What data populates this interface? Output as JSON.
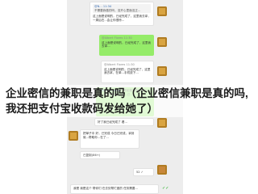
{
  "overlay": {
    "title": "企业密信的兼职是真的吗（企业密信兼职是真的吗,我还把支付宝收款码发给她了）"
  },
  "chat": {
    "top_quote": "@N... 11:34",
    "top_quote_body": "不需要我做的吗，没开心里面没正...",
    "top_reply": "这上面是说明的，已经完成了，这里我去拿，一周后在...会让你很惊...",
    "msg1_time": "@Albert Flores 11:30",
    "msg1_text": "这上面是说明的，已经完成了，这里我去拿...",
    "msg2_time": "@Albert Flores 11:30",
    "msg2_text": "这上面是说明的，已经完成了，这里我去拿，在单...手机放下...",
    "msg3_mention": "@Albert Flores",
    "msg3_text": "应是前报名表完成中的，单任务完成，新...已...",
    "msg4_time": "@Albert Flores",
    "msg4_text": "好了我已经完成了 看...",
    "msg5_text": "把单子中 好，已完成 今日已完成，拿到就...帮助你...在了...",
    "msg6_text": "已复制(86+)",
    "msg7_amount": "52 ✓",
    "bottom_text": "我是 我是这个 帮你们 在去处帮忙做的 任务需要...",
    "checks": "✓✓"
  }
}
